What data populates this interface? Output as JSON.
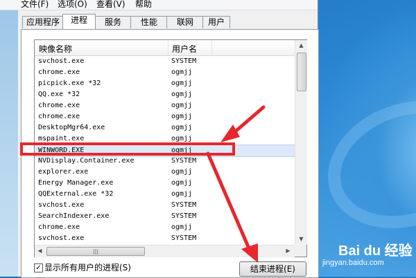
{
  "menu": [
    {
      "label": "文件(F)"
    },
    {
      "label": "选项(O)"
    },
    {
      "label": "查看(V)"
    },
    {
      "label": "帮助"
    }
  ],
  "tabs": [
    "应用程序",
    "进程",
    "服务",
    "性能",
    "联网",
    "用户"
  ],
  "active_tab": "进程",
  "process_list": {
    "columns": [
      "映像名称",
      "用户名"
    ],
    "rows": [
      {
        "image": "svchost.exe",
        "user": "SYSTEM"
      },
      {
        "image": "chrome.exe",
        "user": "ogmjj"
      },
      {
        "image": "picpick.exe *32",
        "user": "ogmjj"
      },
      {
        "image": "QQ.exe *32",
        "user": "ogmjj"
      },
      {
        "image": "chrome.exe",
        "user": "ogmjj"
      },
      {
        "image": "chrome.exe",
        "user": "ogmjj"
      },
      {
        "image": "DesktopMgr64.exe",
        "user": "ogmjj"
      },
      {
        "image": "mspaint.exe",
        "user": "ogmjj"
      },
      {
        "image": "WINWORD.EXE",
        "user": "ogmjj"
      },
      {
        "image": "NVDisplay.Container.exe",
        "user": "SYSTEM"
      },
      {
        "image": "explorer.exe",
        "user": "ogmjj"
      },
      {
        "image": "Energy Manager.exe",
        "user": "ogmjj"
      },
      {
        "image": "QQExternal.exe *32",
        "user": "ogmjj"
      },
      {
        "image": "svchost.exe",
        "user": "SYSTEM"
      },
      {
        "image": "SearchIndexer.exe",
        "user": "SYSTEM"
      },
      {
        "image": "chrome.exe",
        "user": "ogmjj"
      },
      {
        "image": "svchost.exe",
        "user": "SYSTEM"
      }
    ],
    "selected_image": "WINWORD.EXE"
  },
  "footer": {
    "show_all_label": "显示所有用户的进程(S)",
    "show_all_checked": "✓",
    "end_process_label": "结束进程(E)"
  },
  "watermark": {
    "logo": "Bai du 经验",
    "url": "jingyan.baidu.com"
  },
  "colors": {
    "highlight": "#e8262c",
    "selected_row": "#dce9f8",
    "desktop": "#2a86d2"
  }
}
